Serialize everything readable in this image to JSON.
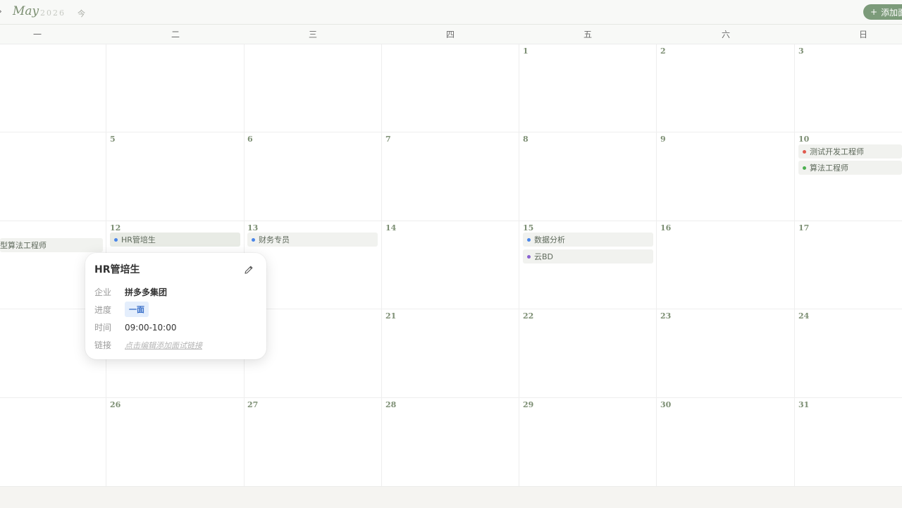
{
  "header": {
    "month": "May",
    "year": "2026",
    "today_label": "今",
    "add_label": "添加面试"
  },
  "weekdays": [
    "一",
    "二",
    "三",
    "四",
    "五",
    "六",
    "日"
  ],
  "weeks": [
    [
      "",
      "",
      "",
      "",
      "1",
      "2",
      "3"
    ],
    [
      "",
      "5",
      "6",
      "7",
      "8",
      "9",
      "10"
    ],
    [
      "",
      "12",
      "13",
      "14",
      "15",
      "16",
      "17"
    ],
    [
      "",
      "",
      "",
      "",
      "21",
      "22",
      "23",
      "24"
    ],
    [
      "",
      "26",
      "27",
      "28",
      "29",
      "30",
      "31"
    ]
  ],
  "events": [
    {
      "title": "测试开发工程师",
      "color": "#e05a4e"
    },
    {
      "title": "算法工程师",
      "color": "#4caf50"
    },
    {
      "title": "型算法工程师",
      "color": ""
    },
    {
      "title": "HR管培生",
      "color": "#4a86e8"
    },
    {
      "title": "财务专员",
      "color": "#4a86e8"
    },
    {
      "title": "数据分析",
      "color": "#4a86e8"
    },
    {
      "title": "云BD",
      "color": "#8a63d2"
    }
  ],
  "popup": {
    "title": "HR管培生",
    "company_label": "企业",
    "company": "拼多多集团",
    "stage_label": "进度",
    "stage": "一面",
    "time_label": "时间",
    "time": "09:00-10:00",
    "link_label": "链接",
    "link_placeholder": "点击编辑添加面试链接"
  }
}
